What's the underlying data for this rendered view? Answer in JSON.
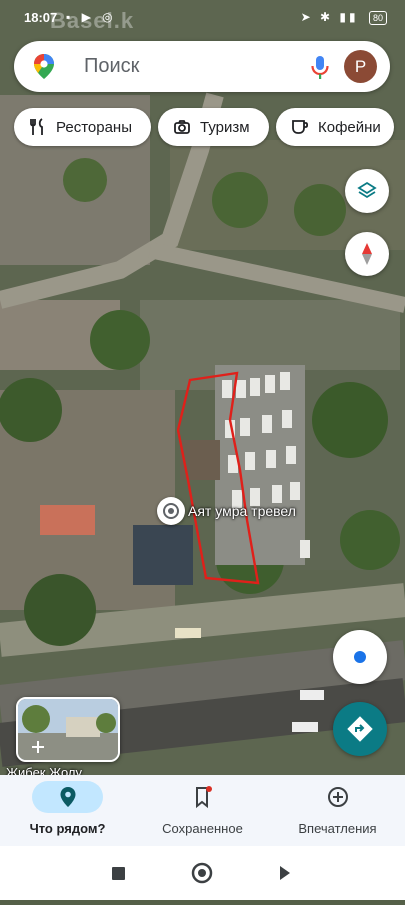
{
  "status_bar": {
    "time": "18:07",
    "battery": "80",
    "watermark": "Basel.k"
  },
  "search": {
    "placeholder": "Поиск",
    "avatar_letter": "P"
  },
  "chips": [
    {
      "label": "Рестораны",
      "icon": "restaurant-icon"
    },
    {
      "label": "Туризм",
      "icon": "attraction-icon"
    },
    {
      "label": "Кофейни",
      "icon": "coffee-icon"
    }
  ],
  "map": {
    "place_label": "Аят умра тревел",
    "street_label": "Жибек Жолу"
  },
  "bottom_nav": [
    {
      "label": "Что рядом?",
      "icon": "explore-pin-icon",
      "active": true
    },
    {
      "label": "Сохраненное",
      "icon": "bookmark-icon",
      "active": false
    },
    {
      "label": "Впечатления",
      "icon": "add-circle-icon",
      "active": false
    }
  ],
  "colors": {
    "accent": "#1a73e8",
    "teal": "#0b7b85",
    "active_pill": "#c2e7ff",
    "annotation_red": "#e0201a"
  }
}
